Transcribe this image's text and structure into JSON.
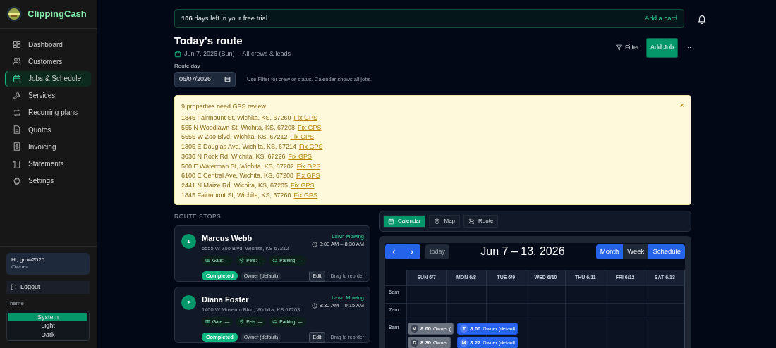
{
  "sidebar": {
    "brand": "ClippingCash",
    "items": [
      {
        "label": "Dashboard",
        "selected": false
      },
      {
        "label": "Customers",
        "selected": false
      },
      {
        "label": "Jobs & Schedule",
        "selected": true
      },
      {
        "label": "Services",
        "selected": false
      },
      {
        "label": "Recurring plans",
        "selected": false
      },
      {
        "label": "Quotes",
        "selected": false
      },
      {
        "label": "Invoicing",
        "selected": false
      },
      {
        "label": "Statements",
        "selected": false
      },
      {
        "label": "Settings",
        "selected": false
      }
    ],
    "user": {
      "greeting": "Hi, grow2525",
      "role": "Owner"
    },
    "logout": "Logout",
    "theme_label": "Theme",
    "theme_options": [
      {
        "label": "System",
        "selected": true
      },
      {
        "label": "Light",
        "selected": false
      },
      {
        "label": "Dark",
        "selected": false
      }
    ]
  },
  "trial_banner": {
    "text": "**106** days left in your free trial.",
    "action": "Add a card"
  },
  "header": {
    "title": "Today's route",
    "date": "Jun 7, 2026 (Sun)",
    "separator": "·",
    "scope": "All crews & leads",
    "filter": "Filter",
    "add": "Add Job",
    "more": "···"
  },
  "route_day": {
    "label": "Route day",
    "value": "06/07/2026",
    "hint": "Use Filter for crew or status. Calendar shows all jobs."
  },
  "gps_alert": {
    "title": "9 properties need GPS review",
    "close": "×",
    "properties": [
      {
        "address": "1845 Fairmount St, Wichita, KS, 67260",
        "link": "Fix GPS"
      },
      {
        "address": "555 N Woodlawn St, Wichita, KS, 67208",
        "link": "Fix GPS"
      },
      {
        "address": "5555 W Zoo Blvd, Wichita, KS, 67212",
        "link": "Fix GPS"
      },
      {
        "address": "1305 E Douglas Ave, Wichita, KS, 67214",
        "link": "Fix GPS"
      },
      {
        "address": "3636 N Rock Rd, Wichita, KS, 67226",
        "link": "Fix GPS"
      },
      {
        "address": "500 E Waterman St, Wichita, KS, 67202",
        "link": "Fix GPS"
      },
      {
        "address": "6100 E Central Ave, Wichita, KS, 67208",
        "link": "Fix GPS"
      },
      {
        "address": "2441 N Maize Rd, Wichita, KS, 67205",
        "link": "Fix GPS"
      },
      {
        "address": "1845 Fairmount St, Wichita, KS, 67260",
        "link": "Fix GPS"
      }
    ]
  },
  "route_stops": {
    "title": "ROUTE STOPS",
    "stops": [
      {
        "number": "1",
        "name": "Marcus Webb",
        "address": "5555 W Zoo Blvd, Wichita, KS 67212",
        "service": "Lawn Mowing",
        "time": "8:00 AM – 8:30 AM",
        "gate": "Gate: —",
        "pets": "Pets: —",
        "parking": "Parking: —",
        "status": "Completed",
        "crew": "Owner (default)",
        "edit": "Edit",
        "drag": "Drag to reorder"
      },
      {
        "number": "2",
        "name": "Diana Foster",
        "address": "1400 W Museum Blvd, Wichita, KS 67203",
        "service": "Lawn Mowing",
        "time": "8:30 AM – 9:15 AM",
        "gate": "Gate: —",
        "pets": "Pets: —",
        "parking": "Parking: —",
        "status": "Completed",
        "crew": "Owner (default)",
        "edit": "Edit",
        "drag": "Drag to reorder"
      }
    ]
  },
  "view_tabs": [
    {
      "label": "Calendar",
      "selected": true
    },
    {
      "label": "Map",
      "selected": false
    },
    {
      "label": "Route",
      "selected": false
    }
  ],
  "calendar": {
    "prev": "‹",
    "next": "›",
    "today": "today",
    "range": "Jun 7 – 13, 2026",
    "views": [
      {
        "label": "Month",
        "selected": false
      },
      {
        "label": "Week",
        "selected": true
      },
      {
        "label": "Schedule",
        "selected": false
      }
    ],
    "hours": [
      "6am",
      "7am",
      "8am"
    ],
    "days": [
      {
        "label": "SUN 6/7",
        "events": [
          {
            "initial": "M",
            "time": "8:00",
            "crew": "Owner (",
            "completed": true
          },
          {
            "initial": "D",
            "time": "8:30",
            "crew": "Owner",
            "completed": true
          }
        ]
      },
      {
        "label": "MON 6/8",
        "events": [
          {
            "initial": "T",
            "time": "8:00",
            "crew": "Owner (default",
            "completed": false
          },
          {
            "initial": "M",
            "time": "8:22",
            "crew": "Owner (default",
            "completed": false
          }
        ]
      },
      {
        "label": "TUE 6/9"
      },
      {
        "label": "WED 6/10"
      },
      {
        "label": "THU 6/11"
      },
      {
        "label": "FRI 6/12"
      },
      {
        "label": "SAT 6/13"
      }
    ]
  }
}
